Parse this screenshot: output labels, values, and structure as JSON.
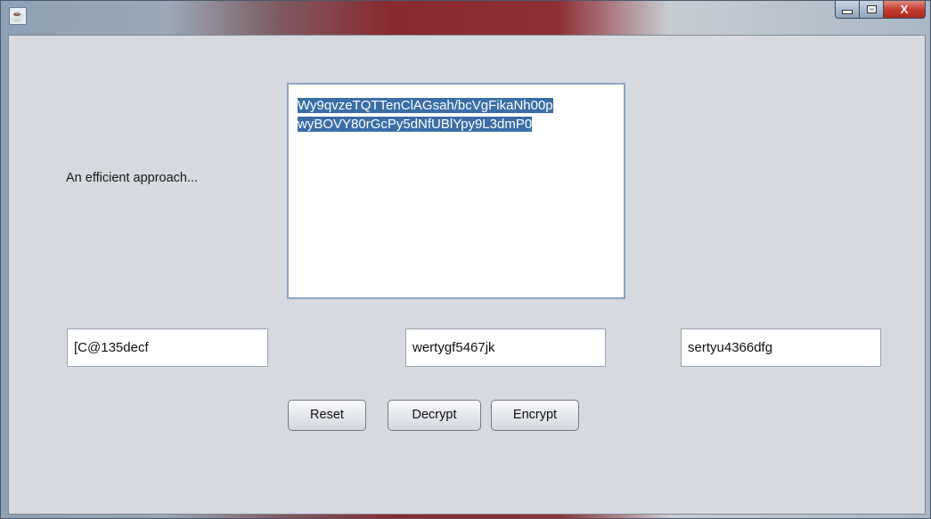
{
  "window": {
    "app_icon": "java-cup-icon",
    "controls": {
      "minimize": "minimize-icon",
      "maximize": "maximize-icon",
      "close_label": "X"
    }
  },
  "main": {
    "description_label": "An efficient approach...",
    "output_text": {
      "line1": "Wy9qvzeTQTTenClAGsah/bcVgFikaNh00p",
      "line2": "wyBOVY80rGcPy5dNfUBlYpy9L3dmP0"
    },
    "fields": {
      "left": "[C@135decf",
      "middle": "wertygf5467jk",
      "right": "sertyu4366dfg"
    },
    "buttons": {
      "reset": "Reset",
      "decrypt": "Decrypt",
      "encrypt": "Encrypt"
    }
  },
  "colors": {
    "selection": "#3a6ea5",
    "panel": "#d6d9df",
    "close_button": "#c0392b"
  }
}
